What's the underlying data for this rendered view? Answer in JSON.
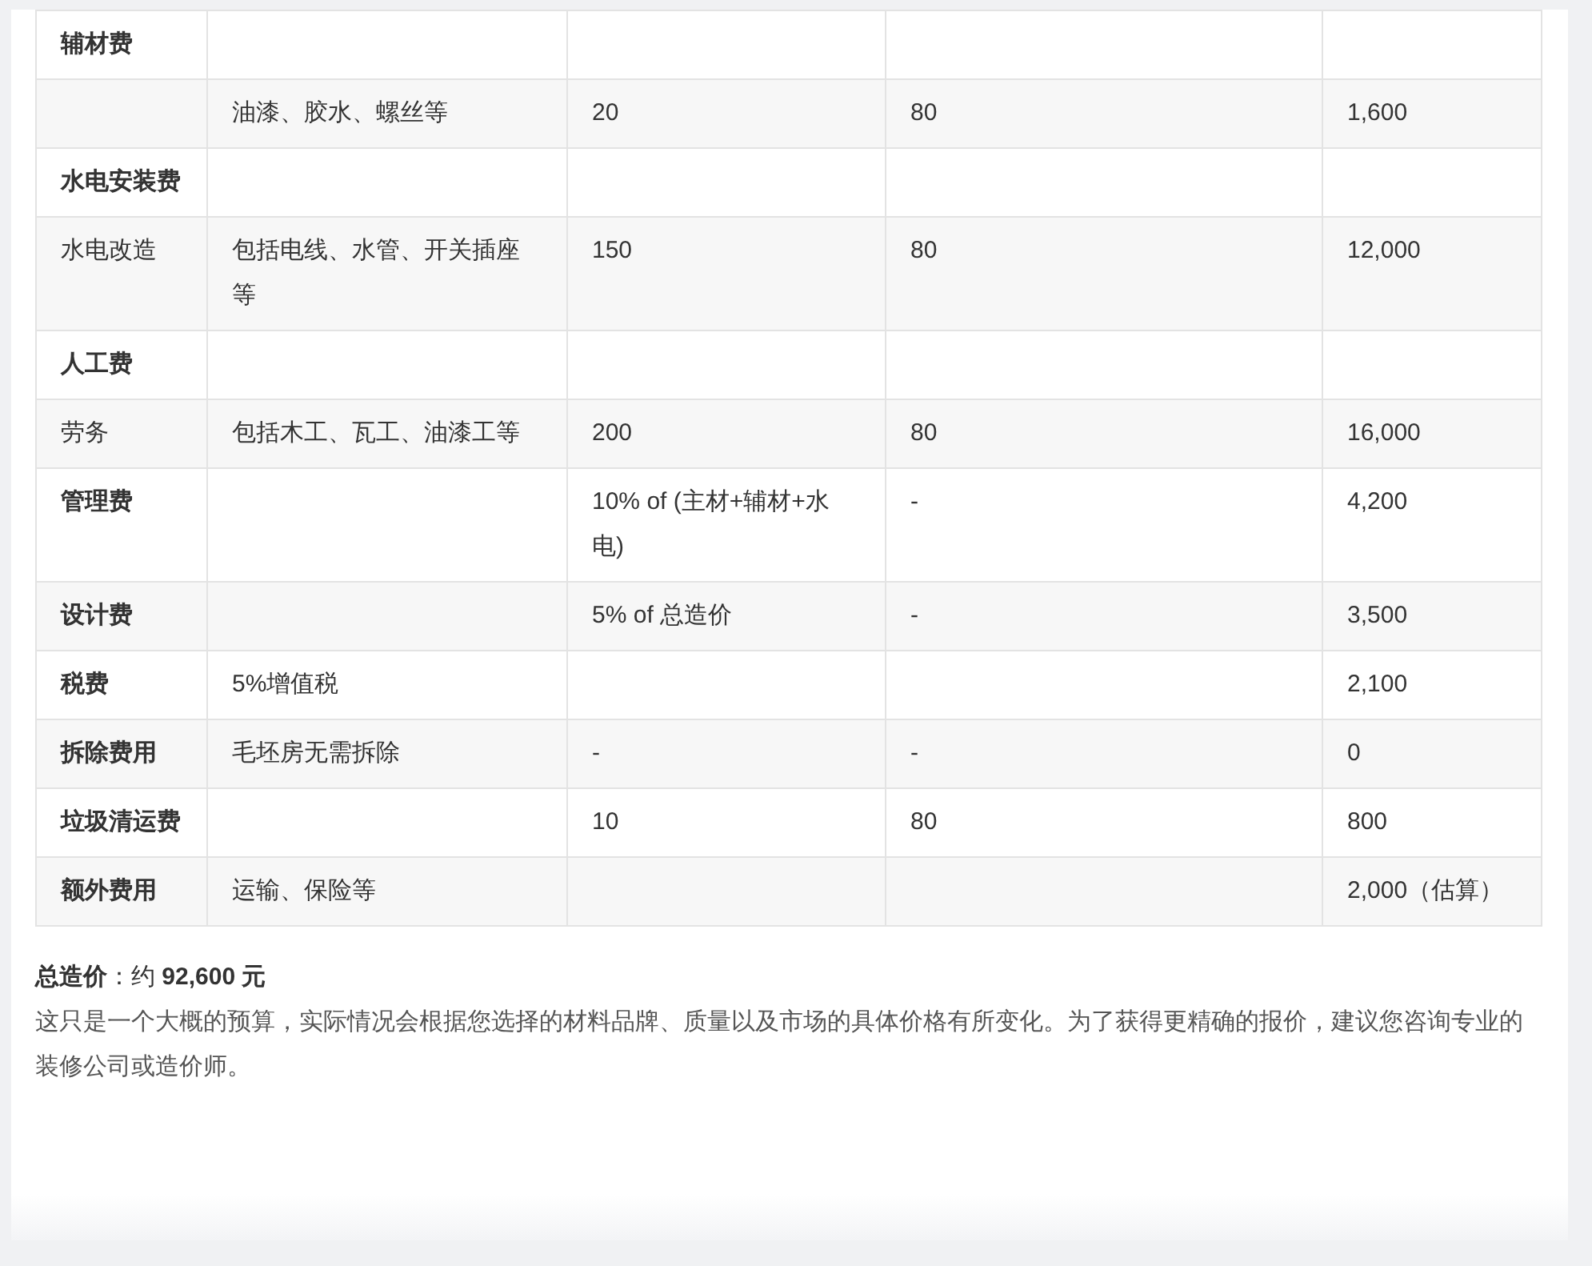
{
  "table": {
    "rows": [
      {
        "kind": "group",
        "cells": [
          "辅材费",
          "",
          "",
          "",
          ""
        ]
      },
      {
        "kind": "item",
        "cells": [
          "",
          "油漆、胶水、螺丝等",
          "20",
          "80",
          "1,600"
        ]
      },
      {
        "kind": "group",
        "cells": [
          "水电安装费",
          "",
          "",
          "",
          ""
        ]
      },
      {
        "kind": "item",
        "cells": [
          "水电改造",
          "包括电线、水管、开关插座等",
          "150",
          "80",
          "12,000"
        ]
      },
      {
        "kind": "group",
        "cells": [
          "人工费",
          "",
          "",
          "",
          ""
        ]
      },
      {
        "kind": "item",
        "cells": [
          "劳务",
          "包括木工、瓦工、油漆工等",
          "200",
          "80",
          "16,000"
        ]
      },
      {
        "kind": "group",
        "cells": [
          "管理费",
          "",
          "10% of (主材+辅材+水电)",
          "-",
          "4,200"
        ]
      },
      {
        "kind": "group",
        "cells": [
          "设计费",
          "",
          "5% of 总造价",
          "-",
          "3,500"
        ]
      },
      {
        "kind": "group",
        "cells": [
          "税费",
          "5%增值税",
          "",
          "",
          "2,100"
        ]
      },
      {
        "kind": "group",
        "cells": [
          "拆除费用",
          "毛坯房无需拆除",
          "-",
          "-",
          "0"
        ]
      },
      {
        "kind": "group",
        "cells": [
          "垃圾清运费",
          "",
          "10",
          "80",
          "800"
        ]
      },
      {
        "kind": "group",
        "cells": [
          "额外费用",
          "运输、保险等",
          "",
          "",
          "2,000（估算）"
        ]
      }
    ]
  },
  "total": "**总造价**：约 **92,600 元**",
  "note": "这只是一个大概的预算，实际情况会根据您选择的材料品牌、质量以及市场的具体价格有所变化。为了获得更精确的报价，建议您咨询专业的装修公司或造价师。"
}
